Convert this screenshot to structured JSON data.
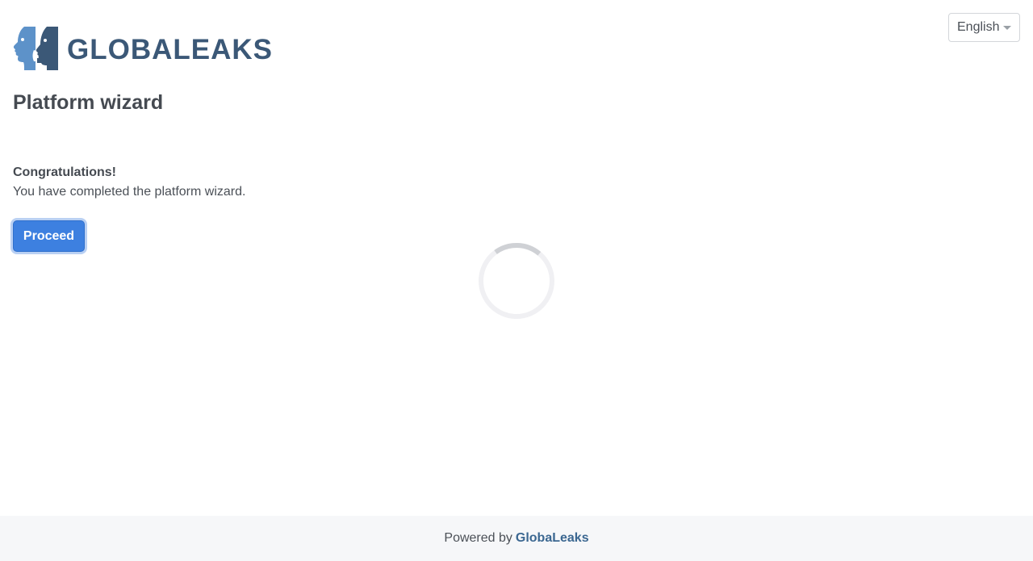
{
  "header": {
    "logo_text": "GLOBALEAKS",
    "logo_icon": "globaleaks-faces-icon"
  },
  "language_selector": {
    "selected": "English",
    "icon": "caret-down-icon"
  },
  "main": {
    "title": "Platform wizard",
    "congrats_heading": "Congratulations!",
    "congrats_message": "You have completed the platform wizard.",
    "proceed_label": "Proceed"
  },
  "spinner": {
    "icon": "loading-spinner-icon"
  },
  "footer": {
    "prefix": "Powered by",
    "link_text": "GlobaLeaks"
  },
  "colors": {
    "brand": "#3b5877",
    "brand_light": "#5d92c9",
    "primary_button": "#3d80e0",
    "footer_bg": "#f6f7f9",
    "footer_link": "#3b6791"
  }
}
